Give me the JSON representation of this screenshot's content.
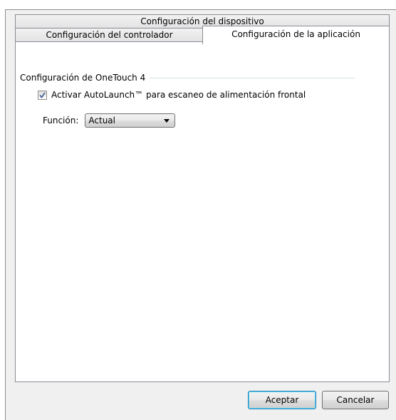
{
  "tabs": {
    "device": "Configuración del dispositivo",
    "driver": "Configuración del controlador",
    "application": "Configuración de la aplicación",
    "selected": "application"
  },
  "group": {
    "title": "Configuración de OneTouch 4"
  },
  "autolaunch": {
    "label": "Activar AutoLaunch™ para escaneo de alimentación frontal",
    "checked": true
  },
  "funcion": {
    "label": "Función:",
    "value": "Actual"
  },
  "buttons": {
    "ok": "Aceptar",
    "cancel": "Cancelar"
  },
  "colors": {
    "checkmark": "#4a5f97",
    "default_button_border": "#3c7fb1"
  }
}
